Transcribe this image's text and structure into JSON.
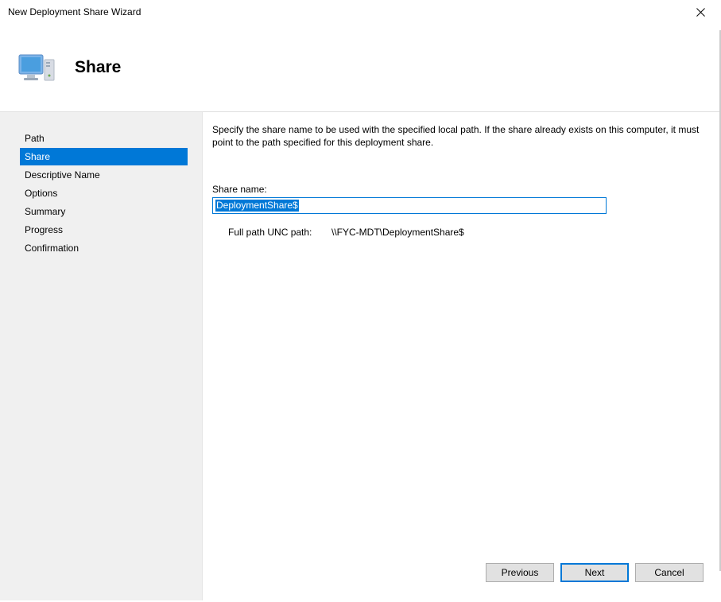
{
  "window": {
    "title": "New Deployment Share Wizard"
  },
  "header": {
    "title": "Share"
  },
  "sidebar": {
    "items": [
      {
        "label": "Path",
        "active": false
      },
      {
        "label": "Share",
        "active": true
      },
      {
        "label": "Descriptive Name",
        "active": false
      },
      {
        "label": "Options",
        "active": false
      },
      {
        "label": "Summary",
        "active": false
      },
      {
        "label": "Progress",
        "active": false
      },
      {
        "label": "Confirmation",
        "active": false
      }
    ]
  },
  "content": {
    "instruction": "Specify the share name to be used with the specified local path.  If the share already exists on this computer, it must point to the path specified for this deployment share.",
    "field_label": "Share name:",
    "share_name_value": "DeploymentShare$",
    "unc_label": "Full path UNC path:",
    "unc_value": "\\\\FYC-MDT\\DeploymentShare$"
  },
  "footer": {
    "previous": "Previous",
    "next": "Next",
    "cancel": "Cancel"
  }
}
